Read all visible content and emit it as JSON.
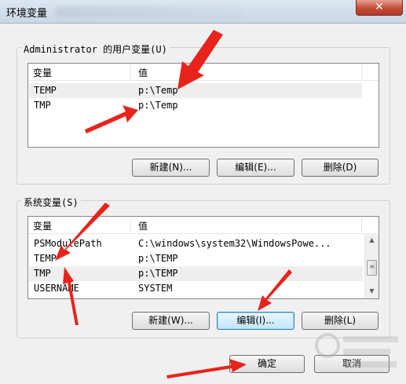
{
  "window": {
    "title": "环境变量",
    "close_glyph": "✕"
  },
  "user_group": {
    "label": "Administrator 的用户变量(U)",
    "headers": {
      "name": "变量",
      "value": "值"
    },
    "rows": [
      {
        "name": "TEMP",
        "value": "p:\\Temp"
      },
      {
        "name": "TMP",
        "value": "p:\\Temp"
      }
    ],
    "buttons": {
      "new": "新建(N)...",
      "edit": "编辑(E)...",
      "delete": "删除(D)"
    }
  },
  "system_group": {
    "label": "系统变量(S)",
    "headers": {
      "name": "变量",
      "value": "值"
    },
    "rows": [
      {
        "name": "PSModulePath",
        "value": "C:\\windows\\system32\\WindowsPowe..."
      },
      {
        "name": "TEMP",
        "value": "p:\\TEMP"
      },
      {
        "name": "TMP",
        "value": "p:\\TEMP"
      },
      {
        "name": "USERNAME",
        "value": "SYSTEM"
      }
    ],
    "buttons": {
      "new": "新建(W)...",
      "edit": "编辑(I)...",
      "delete": "删除(L)"
    }
  },
  "dialog_buttons": {
    "ok": "确定",
    "cancel": "取消"
  },
  "annotation_color": "#e8231c",
  "icons": [
    "close-icon",
    "scroll-up-icon",
    "scroll-down-icon",
    "scroll-thumb-grip-icon",
    "annotation-arrow-icon"
  ]
}
